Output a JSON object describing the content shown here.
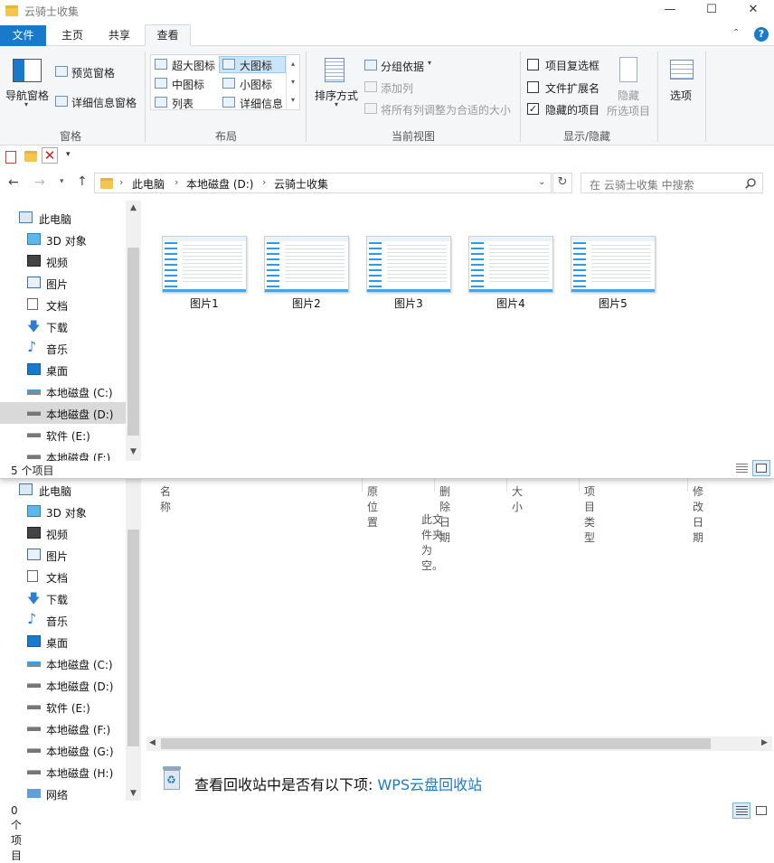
{
  "window": {
    "title": "云骑士收集",
    "controls": [
      "—",
      "☐",
      "✕"
    ]
  },
  "ribbon": {
    "tabs": [
      "文件",
      "主页",
      "共享",
      "查看"
    ],
    "pane_group": {
      "nav_pane": "导航窗格",
      "preview_pane": "预览窗格",
      "details_pane": "详细信息窗格",
      "name": "窗格"
    },
    "layout_group": {
      "items": [
        "超大图标",
        "大图标",
        "中图标",
        "小图标",
        "列表",
        "详细信息"
      ],
      "selected": "大图标",
      "name": "布局"
    },
    "current_view_group": {
      "sort_by": "排序方式",
      "group_by": "分组依据",
      "add_column": "添加列",
      "fit_columns": "将所有列调整为合适的大小",
      "name": "当前视图"
    },
    "show_hide_group": {
      "item_checkboxes": "项目复选框",
      "item_checkboxes_checked": false,
      "file_extensions": "文件扩展名",
      "file_extensions_checked": false,
      "hidden_items": "隐藏的项目",
      "hidden_items_checked": true,
      "hide_selected_line1": "隐藏",
      "hide_selected_line2": "所选项目",
      "name": "显示/隐藏"
    },
    "options": "选项"
  },
  "address": {
    "crumbs": [
      "此电脑",
      "本地磁盘 (D:)",
      "云骑士收集"
    ],
    "search_placeholder": "在 云骑士收集 中搜索"
  },
  "nav_top": [
    {
      "label": "此电脑",
      "icon": "computer-icon"
    },
    {
      "label": "3D 对象",
      "icon": "cube-icon"
    },
    {
      "label": "视频",
      "icon": "video-icon"
    },
    {
      "label": "图片",
      "icon": "picture-icon"
    },
    {
      "label": "文档",
      "icon": "document-icon"
    },
    {
      "label": "下载",
      "icon": "download-icon"
    },
    {
      "label": "音乐",
      "icon": "music-icon"
    },
    {
      "label": "桌面",
      "icon": "desktop-icon"
    },
    {
      "label": "本地磁盘 (C:)",
      "icon": "drive-c-icon"
    },
    {
      "label": "本地磁盘 (D:)",
      "icon": "drive-icon"
    },
    {
      "label": "软件 (E:)",
      "icon": "drive-icon"
    },
    {
      "label": "本地磁盘 (F:)",
      "icon": "drive-icon"
    }
  ],
  "files": [
    "图片1",
    "图片2",
    "图片3",
    "图片4",
    "图片5"
  ],
  "status_top": "5 个项目",
  "nav_bottom": [
    {
      "label": "此电脑",
      "icon": "computer-icon"
    },
    {
      "label": "3D 对象",
      "icon": "cube-icon"
    },
    {
      "label": "视频",
      "icon": "video-icon"
    },
    {
      "label": "图片",
      "icon": "picture-icon"
    },
    {
      "label": "文档",
      "icon": "document-icon"
    },
    {
      "label": "下载",
      "icon": "download-icon"
    },
    {
      "label": "音乐",
      "icon": "music-icon"
    },
    {
      "label": "桌面",
      "icon": "desktop-icon"
    },
    {
      "label": "本地磁盘 (C:)",
      "icon": "drive-c-icon"
    },
    {
      "label": "本地磁盘 (D:)",
      "icon": "drive-icon"
    },
    {
      "label": "软件 (E:)",
      "icon": "drive-icon"
    },
    {
      "label": "本地磁盘 (F:)",
      "icon": "drive-icon"
    },
    {
      "label": "本地磁盘 (G:)",
      "icon": "drive-icon"
    },
    {
      "label": "本地磁盘 (H:)",
      "icon": "drive-icon"
    },
    {
      "label": "网络",
      "icon": "network-icon"
    }
  ],
  "recycle": {
    "columns": [
      "名称",
      "原位置",
      "删除日期",
      "大小",
      "项目类型",
      "修改日期"
    ],
    "empty_text": "此文件夹为空。",
    "promo_text": "查看回收站中是否有以下项: ",
    "promo_link": "WPS云盘回收站"
  },
  "status_bottom": "0 个项目"
}
